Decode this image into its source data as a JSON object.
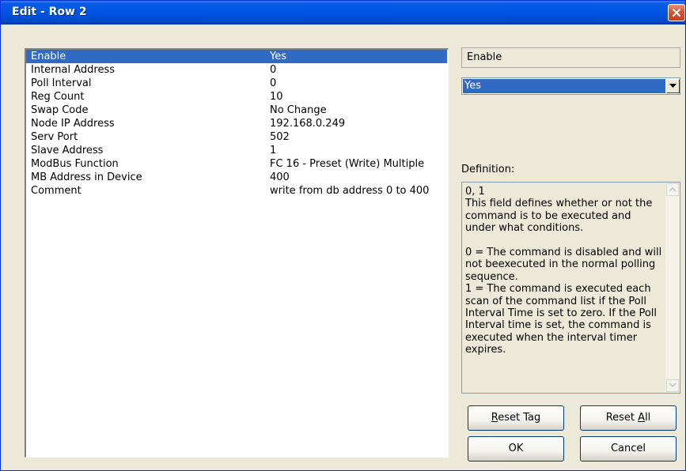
{
  "window": {
    "title": "Edit - Row 2"
  },
  "list": {
    "rows": [
      {
        "name": "Enable",
        "value": "Yes"
      },
      {
        "name": "Internal Address",
        "value": "0"
      },
      {
        "name": "Poll Interval",
        "value": "0"
      },
      {
        "name": "Reg Count",
        "value": "10"
      },
      {
        "name": "Swap Code",
        "value": "No Change"
      },
      {
        "name": "Node IP Address",
        "value": "192.168.0.249"
      },
      {
        "name": "Serv Port",
        "value": "502"
      },
      {
        "name": "Slave Address",
        "value": "1"
      },
      {
        "name": "ModBus Function",
        "value": "FC 16 - Preset (Write) Multiple"
      },
      {
        "name": "MB Address in Device",
        "value": "400"
      },
      {
        "name": "Comment",
        "value": "write from db address 0 to 400"
      }
    ],
    "selected_index": 0
  },
  "editor": {
    "field_name": "Enable",
    "selected_value": "Yes",
    "definition_label": "Definition:",
    "definition_text": "0, 1\nThis field defines whether or not the command is to be executed and under what conditions.\n\n0 = The command is disabled and will not beexecuted in the normal polling sequence.\n1 = The command is executed each scan of the command list if the Poll Interval Time is set to zero. If the Poll Interval time is set, the command is executed when the interval timer expires."
  },
  "buttons": {
    "reset_tag": {
      "pre": "",
      "key": "R",
      "post": "eset Tag"
    },
    "reset_all": {
      "pre": "Reset ",
      "key": "A",
      "post": "ll"
    },
    "ok": "OK",
    "cancel": "Cancel"
  },
  "icons": [
    "close-icon",
    "dropdown-arrow-icon",
    "scroll-up-icon",
    "scroll-down-icon"
  ]
}
